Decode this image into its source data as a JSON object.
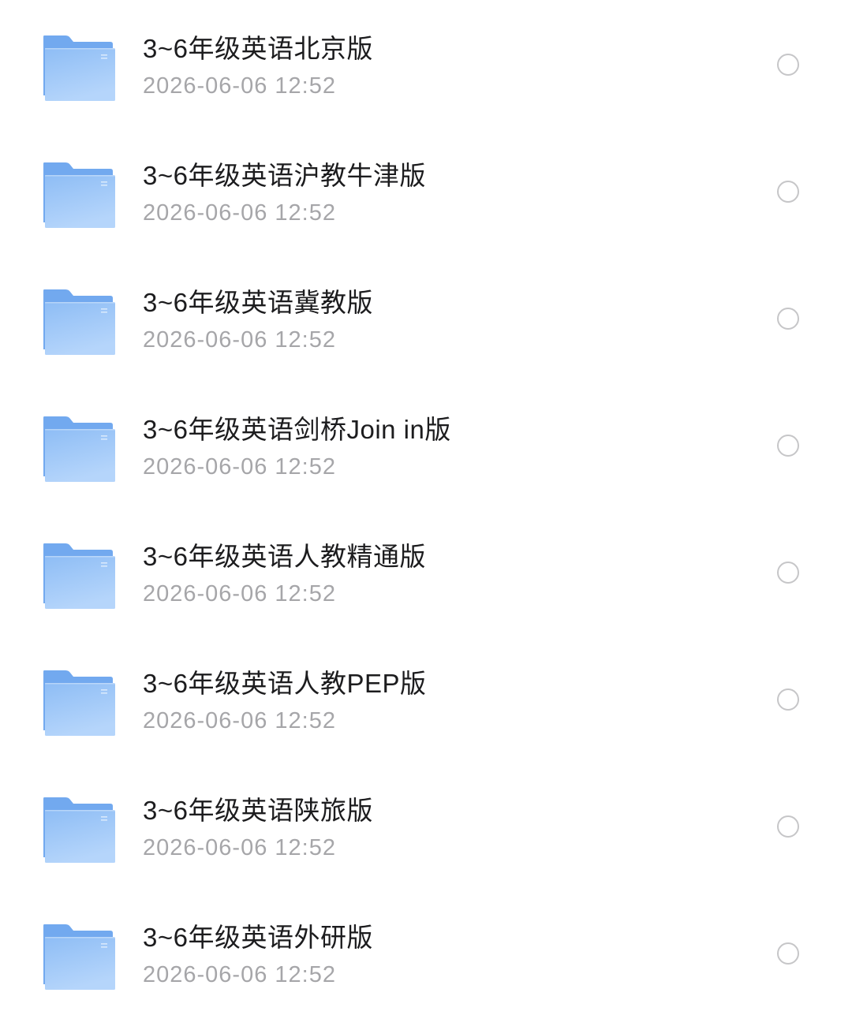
{
  "files": [
    {
      "name": "3~6年级英语北京版",
      "date": "2026-06-06 12:52",
      "selected": false
    },
    {
      "name": "3~6年级英语沪教牛津版",
      "date": "2026-06-06 12:52",
      "selected": false
    },
    {
      "name": "3~6年级英语冀教版",
      "date": "2026-06-06 12:52",
      "selected": false
    },
    {
      "name": "3~6年级英语剑桥Join in版",
      "date": "2026-06-06 12:52",
      "selected": false
    },
    {
      "name": "3~6年级英语人教精通版",
      "date": "2026-06-06 12:52",
      "selected": false
    },
    {
      "name": "3~6年级英语人教PEP版",
      "date": "2026-06-06 12:52",
      "selected": false
    },
    {
      "name": "3~6年级英语陕旅版",
      "date": "2026-06-06 12:52",
      "selected": false
    },
    {
      "name": "3~6年级英语外研版",
      "date": "2026-06-06 12:52",
      "selected": false
    }
  ],
  "icon": "folder-icon",
  "colors": {
    "folder_back": "#72a9ef",
    "folder_front_top": "#8ebdf5",
    "folder_front_bottom": "#b5d5fb",
    "name_text": "#1c1c1e",
    "date_text": "#a6a6a9",
    "radio_border": "#c6c6c8"
  }
}
